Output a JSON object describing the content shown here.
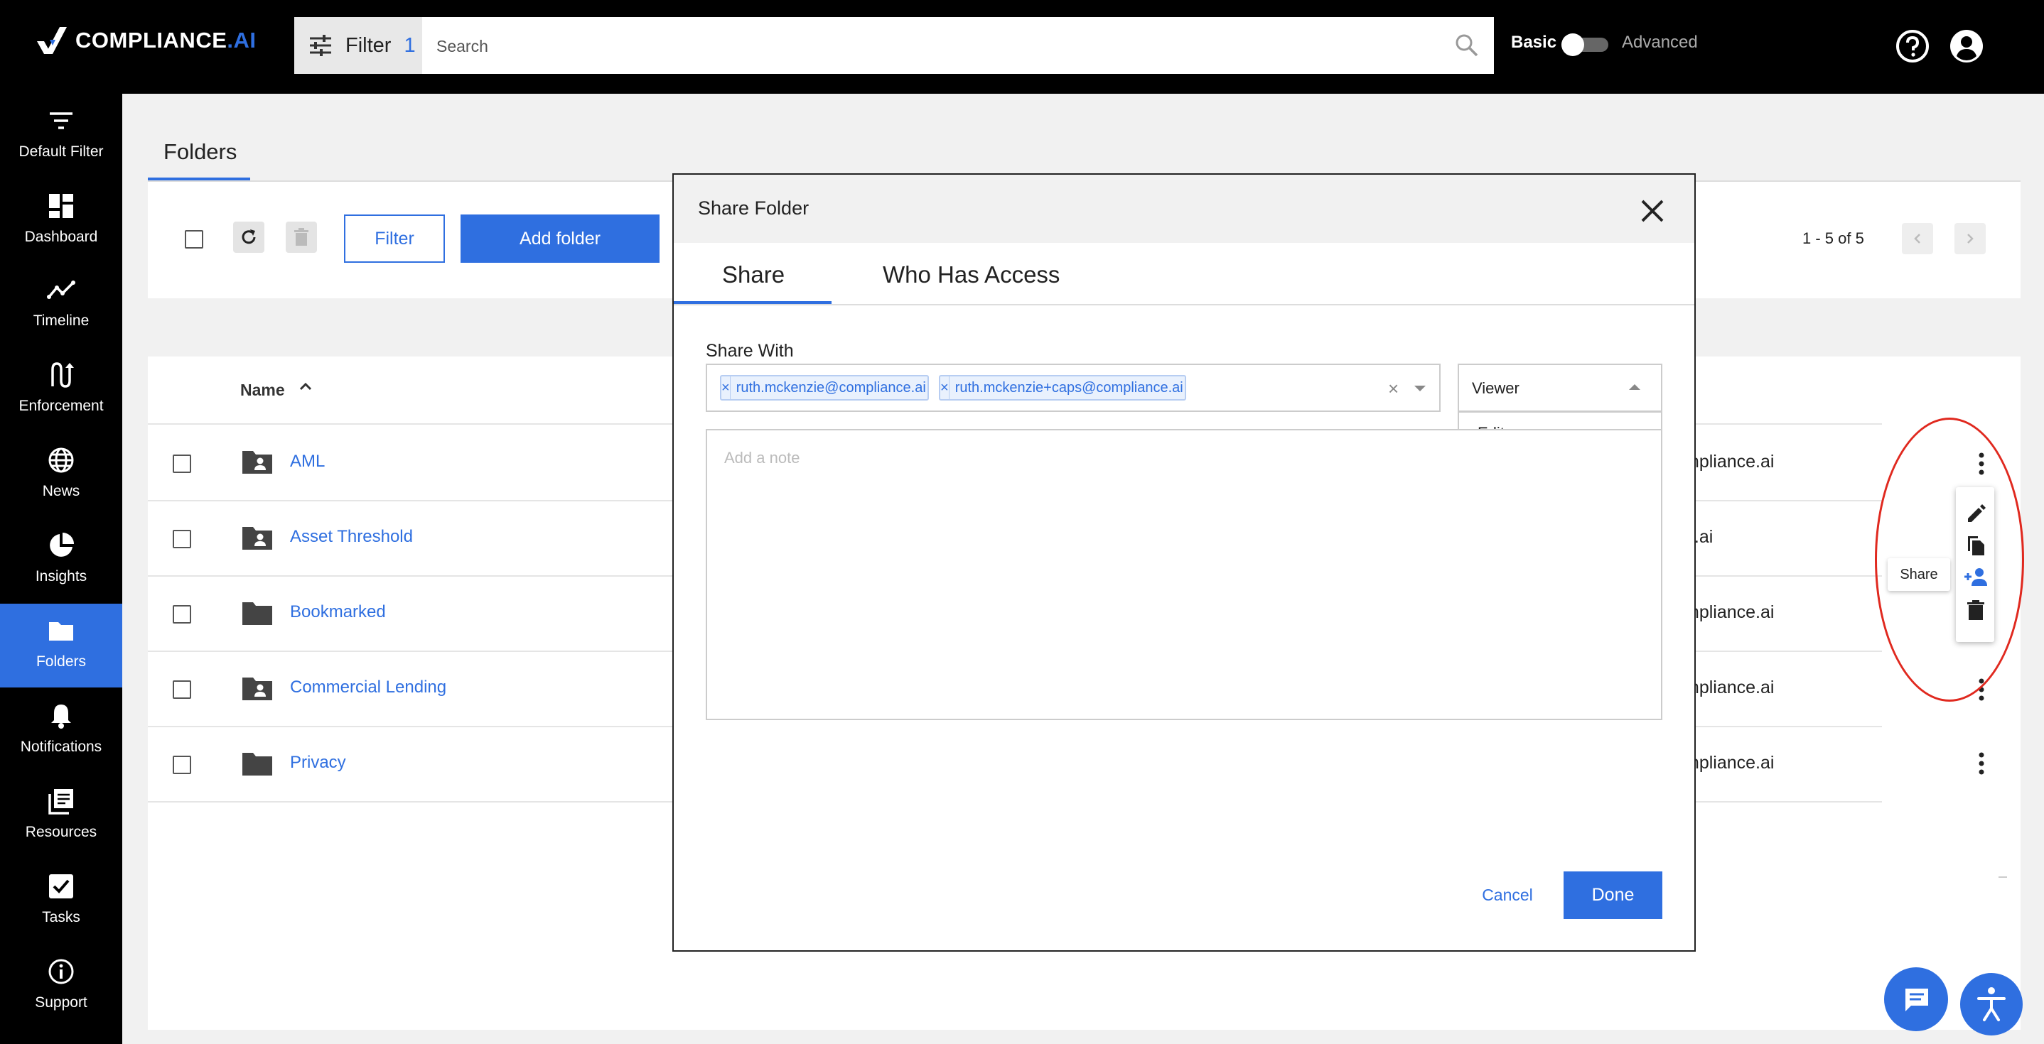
{
  "brand": {
    "name": "COMPLIANCE",
    "suffix": ".AI",
    "accent": "#2f6fe0"
  },
  "topbar": {
    "filter_label": "Filter",
    "filter_count": "1",
    "search_placeholder": "Search",
    "mode_basic": "Basic",
    "mode_advanced": "Advanced"
  },
  "sidebar": {
    "items": [
      {
        "label": "Default Filter",
        "icon": "filter-lines-icon"
      },
      {
        "label": "Dashboard",
        "icon": "dashboard-icon"
      },
      {
        "label": "Timeline",
        "icon": "timeline-icon"
      },
      {
        "label": "Enforcement",
        "icon": "enforcement-icon"
      },
      {
        "label": "News",
        "icon": "globe-icon"
      },
      {
        "label": "Insights",
        "icon": "pie-chart-icon"
      },
      {
        "label": "Folders",
        "icon": "folder-icon",
        "active": true
      },
      {
        "label": "Notifications",
        "icon": "bell-icon"
      },
      {
        "label": "Resources",
        "icon": "resources-icon"
      },
      {
        "label": "Tasks",
        "icon": "checkbox-icon"
      },
      {
        "label": "Support",
        "icon": "info-icon"
      }
    ]
  },
  "folders": {
    "title": "Folders",
    "filter_button": "Filter",
    "add_folder": "Add folder",
    "pagination": "1 - 5 of 5",
    "name_header": "Name",
    "rows": [
      {
        "name": "AML",
        "owner": "mpliance.ai",
        "shared": true
      },
      {
        "name": "Asset Threshold",
        "owner": "e.ai",
        "shared": true
      },
      {
        "name": "Bookmarked",
        "owner": "mpliance.ai",
        "shared": false
      },
      {
        "name": "Commercial Lending",
        "owner": "mpliance.ai",
        "shared": true
      },
      {
        "name": "Privacy",
        "owner": "mpliance.ai",
        "shared": false
      }
    ]
  },
  "row_actions": {
    "tooltip": "Share",
    "icons": [
      "pencil-icon",
      "copy-icon",
      "share-person-icon",
      "trash-icon"
    ]
  },
  "modal": {
    "title": "Share Folder",
    "tabs": [
      "Share",
      "Who Has Access"
    ],
    "share_with_label": "Share With",
    "emails": [
      "ruth.mckenzie@compliance.ai",
      "ruth.mckenzie+caps@compliance.ai"
    ],
    "chip_remove": "×",
    "clear_all": "×",
    "role_selected": "Viewer",
    "role_options": [
      "Editor"
    ],
    "note_placeholder": "Add a note",
    "cancel": "Cancel",
    "done": "Done"
  }
}
